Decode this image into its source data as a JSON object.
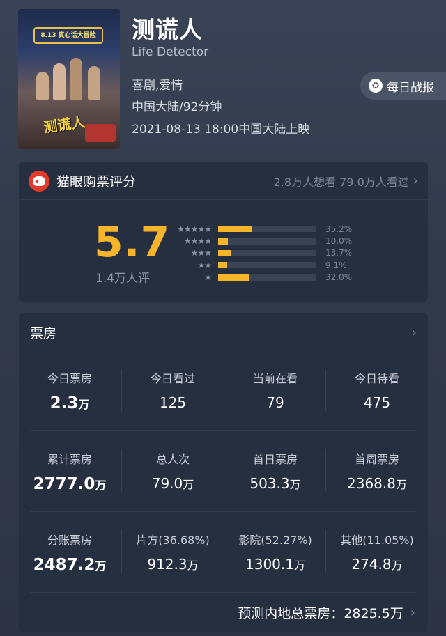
{
  "movie": {
    "title": "测谎人",
    "english_title": "Life Detector",
    "genre": "喜剧,爱情",
    "region_duration": "中国大陆/92分钟",
    "release": "2021-08-13 18:00中国大陆上映",
    "poster": {
      "sign_text": "8.13 真心话大冒险",
      "title_text": "测谎人"
    },
    "daily_report_label": "每日战报"
  },
  "rating": {
    "header": "猫眼购票评分",
    "want_watched": "2.8万人想看 79.0万人看过",
    "score": "5.7",
    "count": "1.4万人评",
    "distribution": [
      {
        "stars": "★★★★★",
        "percent": 35.2,
        "label": "35.2%"
      },
      {
        "stars": "★★★★",
        "percent": 10.0,
        "label": "10.0%"
      },
      {
        "stars": "★★★",
        "percent": 13.7,
        "label": "13.7%"
      },
      {
        "stars": "★★",
        "percent": 9.1,
        "label": "9.1%"
      },
      {
        "stars": "★",
        "percent": 32.0,
        "label": "32.0%"
      }
    ],
    "colors": {
      "accent": "#f7b52b",
      "logo": "#e23b2e"
    }
  },
  "box_office": {
    "header": "票房",
    "rows": [
      [
        {
          "label": "今日票房",
          "value": "2.3",
          "unit": "万"
        },
        {
          "label": "今日看过",
          "value": "125",
          "unit": ""
        },
        {
          "label": "当前在看",
          "value": "79",
          "unit": ""
        },
        {
          "label": "今日待看",
          "value": "475",
          "unit": ""
        }
      ],
      [
        {
          "label": "累计票房",
          "value": "2777.0",
          "unit": "万"
        },
        {
          "label": "总人次",
          "value": "79.0",
          "unit": "万"
        },
        {
          "label": "首日票房",
          "value": "503.3",
          "unit": "万"
        },
        {
          "label": "首周票房",
          "value": "2368.8",
          "unit": "万"
        }
      ],
      [
        {
          "label": "分账票房",
          "value": "2487.2",
          "unit": "万"
        },
        {
          "label": "片方(36.68%)",
          "value": "912.3",
          "unit": "万"
        },
        {
          "label": "影院(52.27%)",
          "value": "1300.1",
          "unit": "万"
        },
        {
          "label": "其他(11.05%)",
          "value": "274.8",
          "unit": "万"
        }
      ]
    ],
    "forecast_label": "预测内地总票房：",
    "forecast_value": "2825.5万"
  }
}
